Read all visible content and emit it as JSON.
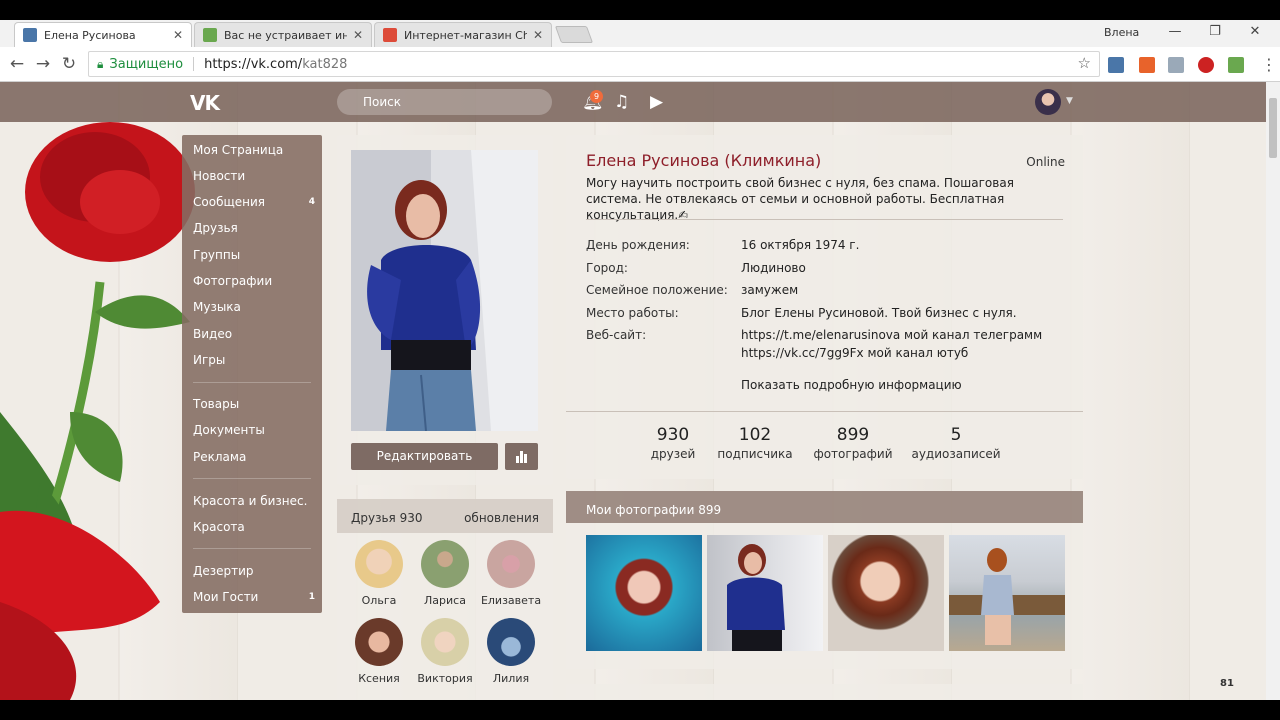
{
  "browser": {
    "tabs": [
      {
        "title": "Елена Русинова",
        "favicon_color": "#4a76a8"
      },
      {
        "title": "Вас не устраивает интер",
        "favicon_color": "#6aa84f"
      },
      {
        "title": "Интернет-магазин Chrc",
        "favicon_color": "#dd4b39"
      }
    ],
    "window_user": "Влена",
    "secure_label": "Защищено",
    "url_host": "https://vk.com/",
    "url_path": "kat828"
  },
  "header": {
    "logo": "VK",
    "search_placeholder": "Поиск",
    "notif_count": "9"
  },
  "menu": {
    "items": [
      {
        "label": "Моя Страница",
        "count": ""
      },
      {
        "label": "Новости",
        "count": ""
      },
      {
        "label": "Сообщения",
        "count": "4"
      },
      {
        "label": "Друзья",
        "count": ""
      },
      {
        "label": "Группы",
        "count": ""
      },
      {
        "label": "Фотографии",
        "count": ""
      },
      {
        "label": "Музыка",
        "count": ""
      },
      {
        "label": "Видео",
        "count": ""
      },
      {
        "label": "Игры",
        "count": ""
      },
      {
        "label": "Товары",
        "count": ""
      },
      {
        "label": "Документы",
        "count": ""
      },
      {
        "label": "Реклама",
        "count": ""
      },
      {
        "label": "Красота и бизнес.",
        "count": ""
      },
      {
        "label": "Красота",
        "count": ""
      },
      {
        "label": "Дезертир",
        "count": ""
      },
      {
        "label": "Мои Гости",
        "count": "1"
      }
    ]
  },
  "profile": {
    "edit_label": "Редактировать",
    "name": "Елена Русинова (Климкина)",
    "online": "Online",
    "status": "Могу научить построить свой бизнес с нуля, без спама. Пошаговая система. Не отвлекаясь от семьи и основной работы. Бесплатная консультация.✍",
    "fields": [
      {
        "label": "День рождения:",
        "value": "16 октября 1974 г."
      },
      {
        "label": "Город:",
        "value": "Людиново"
      },
      {
        "label": "Семейное положение:",
        "value": "замужем"
      },
      {
        "label": "Место работы:",
        "value": "Блог Елены Русиновой. Твой бизнес с нуля."
      },
      {
        "label": "Веб-сайт:",
        "value": "https://t.me/elenarusinova мой канал телеграмм"
      }
    ],
    "website_line2": "https://vk.cc/7gg9Fx мой канал ютуб",
    "show_more": "Показать подробную информацию",
    "counters": [
      {
        "num": "930",
        "label": "друзей"
      },
      {
        "num": "102",
        "label": "подписчика"
      },
      {
        "num": "899",
        "label": "фотографий"
      },
      {
        "num": "5",
        "label": "аудиозаписей"
      }
    ]
  },
  "friends": {
    "title": "Друзья  930",
    "updates": "обновления",
    "list": [
      {
        "name": "Ольга",
        "color": "#e8c98a"
      },
      {
        "name": "Лариса",
        "color": "#8aa070"
      },
      {
        "name": "Елизавета",
        "color": "#c9a5a0"
      },
      {
        "name": "Ксения",
        "color": "#b87a6a"
      },
      {
        "name": "Виктория",
        "color": "#d8d0a8"
      },
      {
        "name": "Лилия",
        "color": "#2a4a78"
      }
    ]
  },
  "photos": {
    "title": "Мои фотографии  899"
  },
  "online_count": "81"
}
